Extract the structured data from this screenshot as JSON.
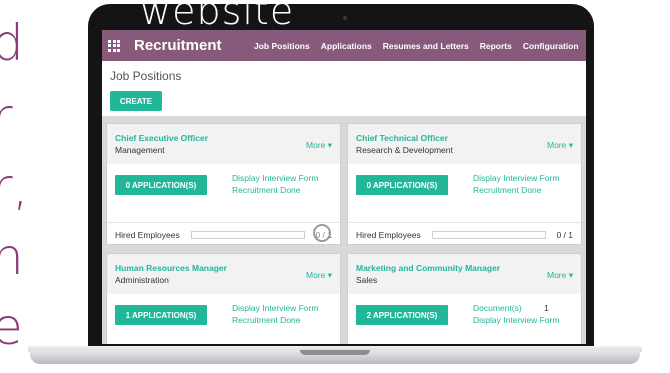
{
  "side_text": [
    "d",
    "r",
    "r,",
    "n",
    "e"
  ],
  "overlay_text": "website",
  "navbar": {
    "app_title": "Recruitment",
    "menu": [
      "Job Positions",
      "Applications",
      "Resumes and Letters",
      "Reports",
      "Configuration"
    ],
    "color": "#875a7b"
  },
  "control_panel": {
    "breadcrumb": "Job Positions",
    "create_label": "CREATE"
  },
  "accent_color": "#21b799",
  "icons": {
    "apps": "grid-icon",
    "more": "caret-down-icon"
  },
  "cards": [
    {
      "title": "Chief Executive Officer",
      "department": "Management",
      "more": "More ▾",
      "applications": "0 APPLICATION(S)",
      "link1": "Display Interview Form",
      "link2": "Recruitment Done",
      "hired_label": "Hired Employees",
      "hired_count": "0 / 1",
      "hired_fraction": 0
    },
    {
      "title": "Chief Technical Officer",
      "department": "Research & Development",
      "more": "More ▾",
      "applications": "0 APPLICATION(S)",
      "link1": "Display Interview Form",
      "link2": "Recruitment Done",
      "hired_label": "Hired Employees",
      "hired_count": "0 / 1",
      "hired_fraction": 0
    },
    {
      "title": "Human Resources Manager",
      "department": "Administration",
      "more": "More ▾",
      "applications": "1 APPLICATION(S)",
      "link1": "Display Interview Form",
      "link2": "Recruitment Done"
    },
    {
      "title": "Marketing and Community Manager",
      "department": "Sales",
      "more": "More ▾",
      "applications": "2 APPLICATION(S)",
      "documents_label": "Document(s)",
      "documents_count": "1",
      "link2": "Display Interview Form"
    }
  ]
}
